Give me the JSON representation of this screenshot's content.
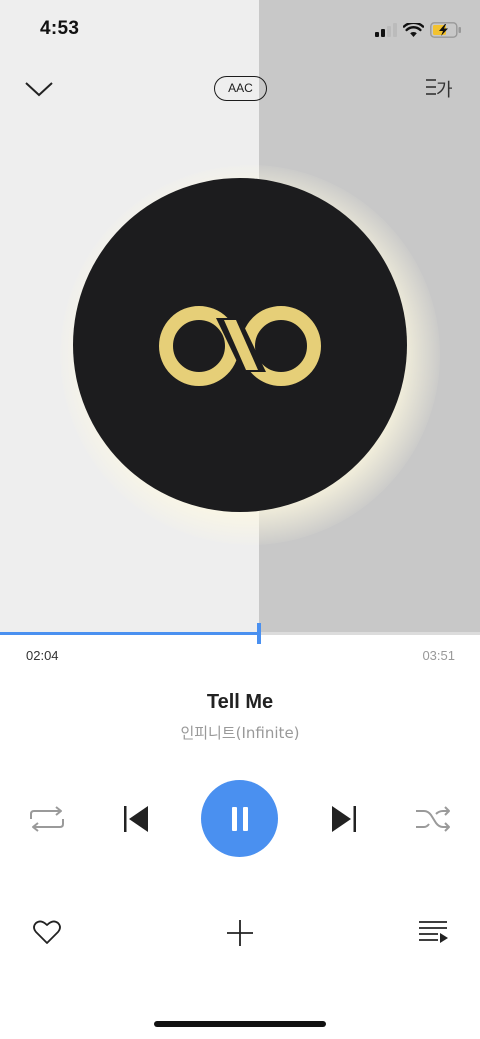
{
  "status_bar": {
    "time": "4:53",
    "icons": [
      "cellular-signal-icon",
      "wifi-icon",
      "battery-charging-icon"
    ]
  },
  "header": {
    "collapse_icon": "chevron-down-icon",
    "codec_label": "AAC",
    "lyrics_icon": "lyrics-icon",
    "lyrics_glyph": "가"
  },
  "album_art": {
    "logo": "infinity-logo",
    "disc_color": "#1c1c1e",
    "logo_color": "#e6cf78"
  },
  "progress": {
    "current_time": "02:04",
    "total_time": "03:51",
    "fraction": 0.539
  },
  "track": {
    "title": "Tell Me",
    "artist": "인피니트(Infinite)"
  },
  "controls": {
    "repeat_icon": "repeat-icon",
    "prev_icon": "skip-previous-icon",
    "play_state_icon": "pause-icon",
    "next_icon": "skip-next-icon",
    "shuffle_icon": "shuffle-icon"
  },
  "actions": {
    "like_icon": "heart-icon",
    "add_icon": "plus-icon",
    "queue_icon": "playlist-icon"
  },
  "colors": {
    "accent": "#4a90f0",
    "muted_text": "#999999",
    "art_left_bg": "#eeeeee",
    "art_right_bg": "#c8c8c8"
  }
}
